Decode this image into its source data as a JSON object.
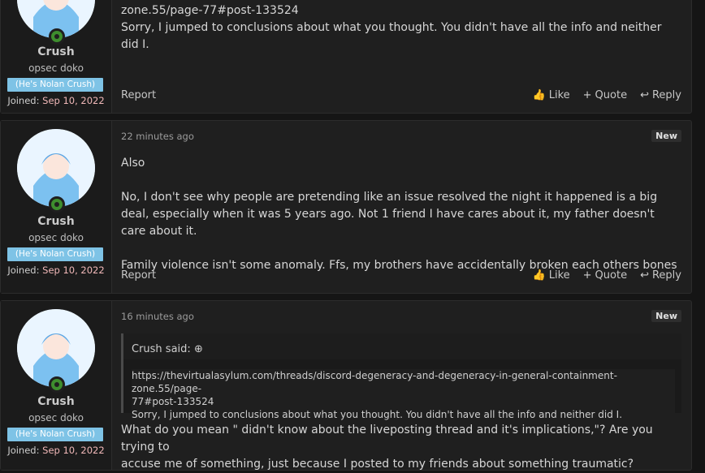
{
  "posts": [
    {
      "user": {
        "name": "Crush",
        "title": "opsec doko",
        "banner": "(He's Nolan Crush)",
        "joined_label": "Joined:",
        "joined_date": "Sep 10, 2022"
      },
      "time": "",
      "body_lines": [
        "zone.55/page-77#post-133524",
        "Sorry, I jumped to conclusions about what you thought. You didn't have all the info and neither did I."
      ],
      "report": "Report",
      "actions": {
        "like": "Like",
        "quote": "Quote",
        "reply": "Reply"
      }
    },
    {
      "user": {
        "name": "Crush",
        "title": "opsec doko",
        "banner": "(He's Nolan Crush)",
        "joined_label": "Joined:",
        "joined_date": "Sep 10, 2022"
      },
      "time": "22 minutes ago",
      "badge": "New",
      "body_paragraphs": [
        "Also",
        "No, I don't see why people are pretending like an issue resolved the night it happened is a big deal, especially when it was 5 years ago. Not 1 friend I have cares about it, my father doesn't care about it.",
        "Family violence isn't some anomaly. Ffs, my brothers have accidentally broken each others bones"
      ],
      "report": "Report",
      "actions": {
        "like": "Like",
        "quote": "Quote",
        "reply": "Reply"
      }
    },
    {
      "user": {
        "name": "Crush",
        "title": "opsec doko",
        "banner": "(He's Nolan Crush)",
        "joined_label": "Joined:",
        "joined_date": "Sep 10, 2022"
      },
      "time": "16 minutes ago",
      "badge": "New",
      "quote": {
        "author": "Crush said:",
        "url_line1": "https://thevirtualasylum.com/threads/discord-degeneracy-and-degeneracy-in-general-containment-zone.55/page-",
        "url_line2": "77#post-133524",
        "text": "Sorry, I jumped to conclusions about what you thought. You didn't have all the info and neither did I."
      },
      "body_lines": [
        "What do you mean \" didn't know about the liveposting thread and it's implications,\"? Are you trying to",
        "accuse me of something, just because I posted to my friends about something traumatic?"
      ]
    }
  ]
}
